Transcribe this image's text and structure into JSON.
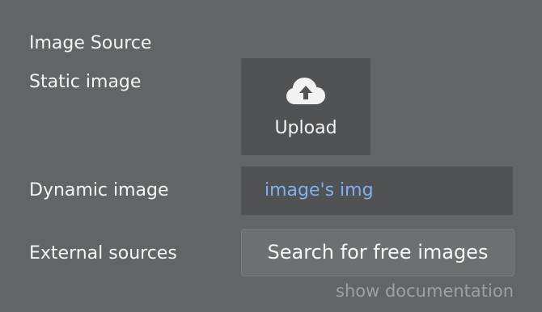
{
  "image_source_section": {
    "title": "Image Source"
  },
  "static_image": {
    "label": "Static image",
    "upload_label": "Upload",
    "upload_icon": "cloud-upload-icon"
  },
  "dynamic_image": {
    "label": "Dynamic image",
    "value": "image's img",
    "value_color": "#7fb0f3"
  },
  "external_sources": {
    "label": "External sources",
    "button_label": "Search for free images"
  },
  "documentation": {
    "link_text": "show documentation"
  },
  "colors": {
    "panel_background": "#626566",
    "field_background": "#505254",
    "button_background": "#6d7072",
    "muted_text": "#9ea1a4"
  }
}
